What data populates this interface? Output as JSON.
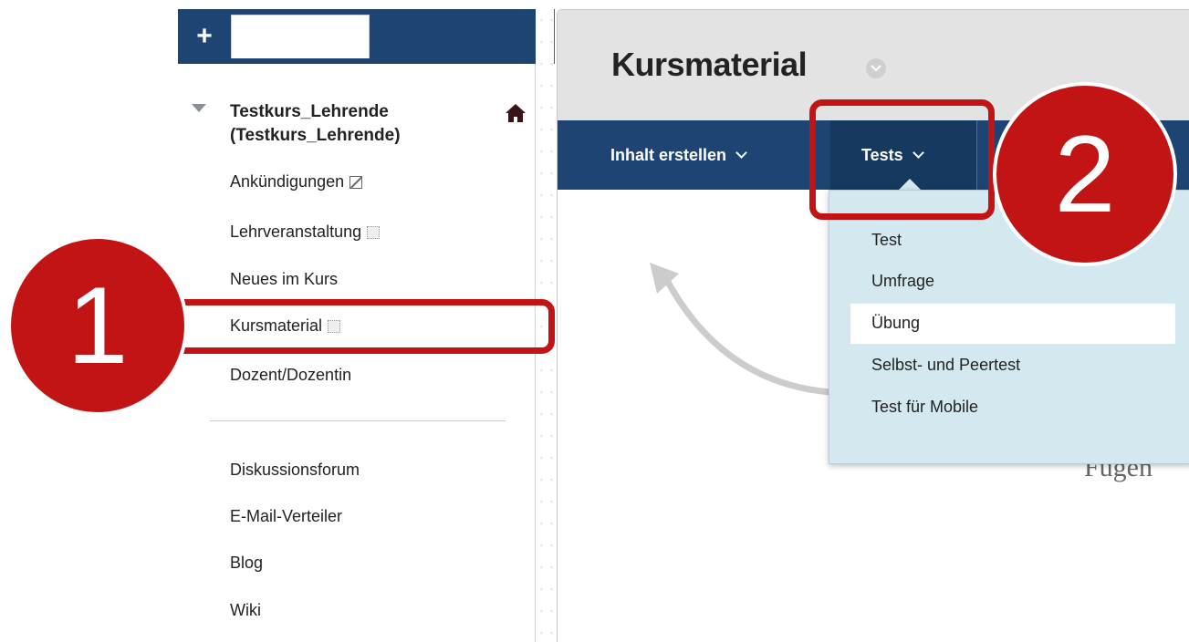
{
  "toolbar": {
    "add_icon": "plus-icon",
    "folder_icon": "folder-icon",
    "refresh_icon": "refresh-icon",
    "sort_icon": "sort-arrows-icon",
    "search_value": ""
  },
  "course": {
    "title": "Testkurs_Lehrende (Testkurs_Lehrende)",
    "home_icon": "home-icon"
  },
  "menu": {
    "items": [
      {
        "label": "Ankündigungen",
        "icon": "hidden-slash-icon"
      },
      {
        "label": "Lehrveranstaltung",
        "icon": "empty-box-icon"
      },
      {
        "label": "Neues im Kurs"
      },
      {
        "label": "Kursmaterial",
        "icon": "empty-box-icon"
      },
      {
        "label": "Dozent/Dozentin"
      }
    ],
    "tools": [
      {
        "label": "Diskussionsforum"
      },
      {
        "label": "E-Mail-Verteiler"
      },
      {
        "label": "Blog"
      },
      {
        "label": "Wiki"
      }
    ]
  },
  "content": {
    "title": "Kursmaterial",
    "action_bar": {
      "inhalt_label": "Inhalt erstellen",
      "tests_label": "Tests"
    },
    "dropdown": {
      "items": [
        "Test",
        "Umfrage",
        "Übung",
        "Selbst- und Peertest",
        "Test für Mobile"
      ],
      "highlighted": "Übung"
    },
    "partial_text": "Fügen"
  },
  "annotations": {
    "badge_1": "1",
    "badge_2": "2",
    "color": "#c21414"
  },
  "colors": {
    "nav_blue": "#1e4473",
    "dropdown_bg": "#d4e8ef",
    "header_gray": "#e3e3e3"
  }
}
